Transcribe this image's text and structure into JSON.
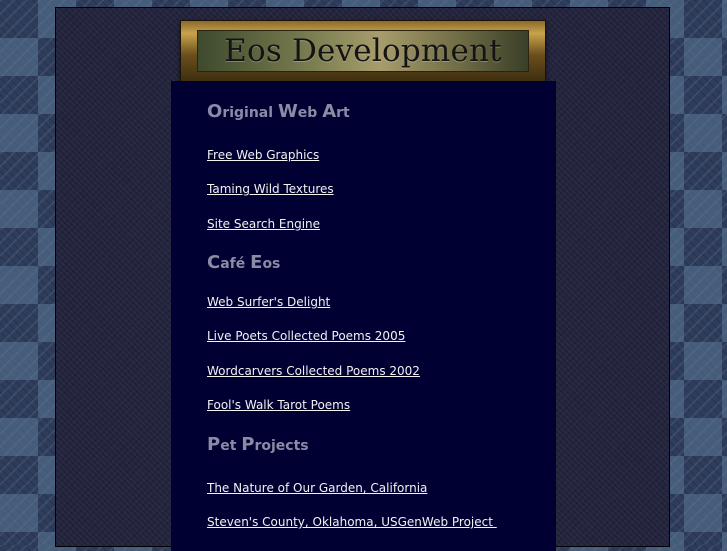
{
  "banner": {
    "title": "Eos Development"
  },
  "sections": [
    {
      "title_cap1": "O",
      "title_rest1": "riginal ",
      "title_cap2": "W",
      "title_rest2": "eb ",
      "title_cap3": "A",
      "title_rest3": "rt",
      "links": [
        "Free Web Graphics",
        "Taming Wild Textures",
        "Site Search Engine"
      ]
    },
    {
      "title_cap1": "C",
      "title_rest1": "afé ",
      "title_cap2": "E",
      "title_rest2": "os",
      "links": [
        "Web Surfer's Delight",
        "Live Poets Collected Poems 2005",
        "Wordcarvers Collected Poems 2002",
        "Fool's Walk Tarot Poems"
      ]
    },
    {
      "title_cap1": "P",
      "title_rest1": "et ",
      "title_cap2": "P",
      "title_rest2": "rojects",
      "links": [
        "The Nature of Our Garden, California",
        "Steven's County, Oklahoma, USGenWeb Project "
      ]
    }
  ]
}
